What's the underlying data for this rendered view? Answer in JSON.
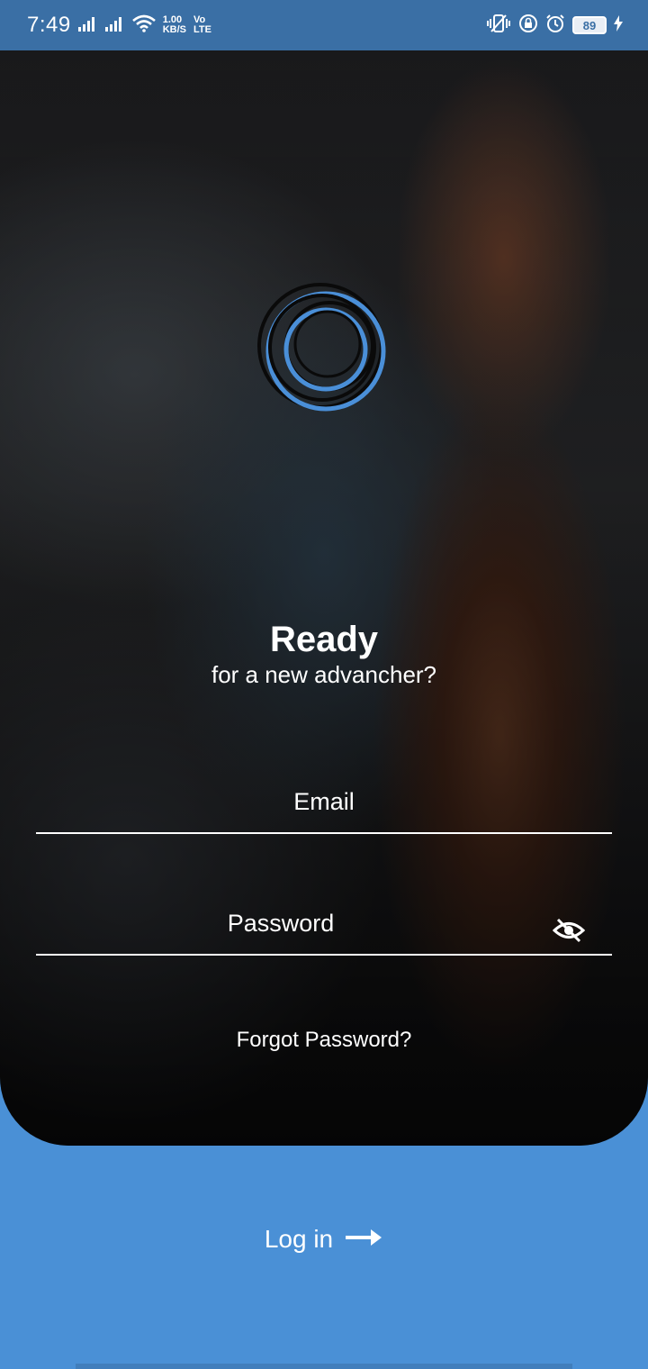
{
  "status_bar": {
    "time": "7:49",
    "speed_value": "1.00",
    "speed_unit": "KB/S",
    "volte_top": "Vo",
    "volte_bottom": "LTE",
    "battery": "89",
    "icons": [
      "signal-icon",
      "signal-icon",
      "wifi-icon",
      "vibrate-icon",
      "rotation-lock-icon",
      "alarm-icon",
      "battery-icon",
      "charging-icon"
    ]
  },
  "hero": {
    "logo": "spiral-logo-icon",
    "title": "Ready",
    "subtitle": "for a new advancher?"
  },
  "form": {
    "email_placeholder": "Email",
    "password_placeholder": "Password",
    "visibility_icon": "eye-off-icon",
    "forgot_label": "Forgot Password?"
  },
  "login": {
    "label": "Log in",
    "icon": "arrow-right-icon"
  },
  "colors": {
    "accent": "#4a90d6",
    "status_bar": "#3a6fa5",
    "logo_blue": "#4a8fd8"
  }
}
